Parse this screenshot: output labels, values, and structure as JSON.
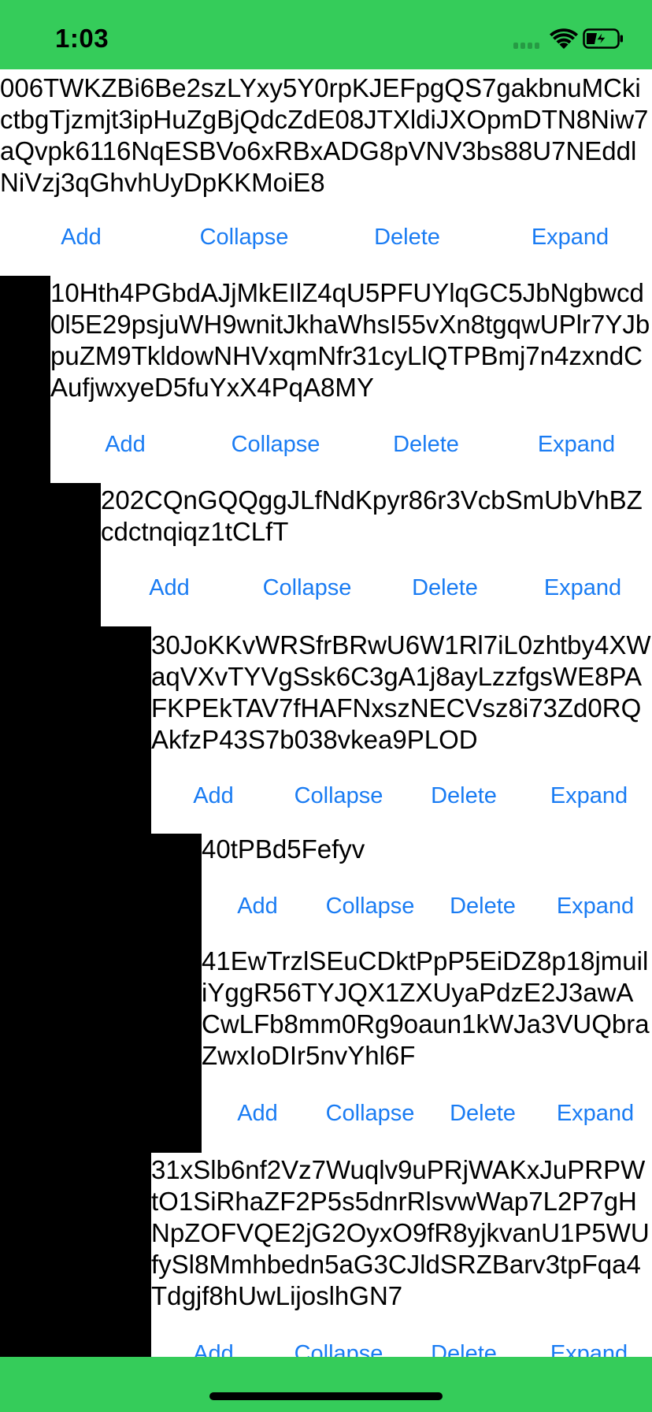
{
  "status_bar": {
    "time": "1:03",
    "icons": [
      "cellular-signal-icon",
      "wifi-icon",
      "battery-charging-icon"
    ]
  },
  "colors": {
    "bars": "#35CC5A",
    "action_text": "#1a7cf3",
    "indent_fill": "#000000"
  },
  "actions": {
    "add": "Add",
    "collapse": "Collapse",
    "delete": "Delete",
    "expand": "Expand"
  },
  "nodes": [
    {
      "depth": 0,
      "text": "006TWKZBi6Be2szLYxy5Y0rpKJEFpgQS7gakbnuMCkictbgTjzmjt3ipHuZgBjQdcZdE08JTXldiJXOpmDTN8Niw7aQvpk6116NqESBVo6xRBxADG8pVNV3bs88U7NEddlNiVzj3qGhvhUyDpKKMoiE8"
    },
    {
      "depth": 1,
      "text": "10Hth4PGbdAJjMkEIlZ4qU5PFUYlqGC5JbNgbwcd0l5E29psjuWH9wnitJkhaWhsI55vXn8tgqwUPlr7YJbpuZM9TkldowNHVxqmNfr31cyLlQTPBmj7n4zxndCAufjwxyeD5fuYxX4PqA8MY"
    },
    {
      "depth": 2,
      "text": "202CQnGQQggJLfNdKpyr86r3VcbSmUbVhBZcdctnqiqz1tCLfT"
    },
    {
      "depth": 3,
      "text": "30JoKKvWRSfrBRwU6W1Rl7iL0zhtby4XWaqVXvTYVgSsk6C3gA1j8ayLzzfgsWE8PAFKPEkTAV7fHAFNxszNECVsz8i73Zd0RQAkfzP43S7b038vkea9PLOD"
    },
    {
      "depth": 4,
      "text": "40tPBd5Fefyv"
    },
    {
      "depth": 4,
      "text": "41EwTrzlSEuCDktPpP5EiDZ8p18jmuiliYggR56TYJQX1ZXUyaPdzE2J3awACwLFb8mm0Rg9oaun1kWJa3VUQbraZwxIoDIr5nvYhl6F"
    },
    {
      "depth": 3,
      "text": "31xSlb6nf2Vz7Wuqlv9uPRjWAKxJuPRPWtO1SiRhaZF2P5s5dnrRlsvwWap7L2P7gHNpZOFVQE2jG2OyxO9fR8yjkvanU1P5WUfySl8Mmhbedn5aG3CJldSRZBarv3tpFqa4Tdgjf8hUwLijoslhGN7"
    }
  ]
}
